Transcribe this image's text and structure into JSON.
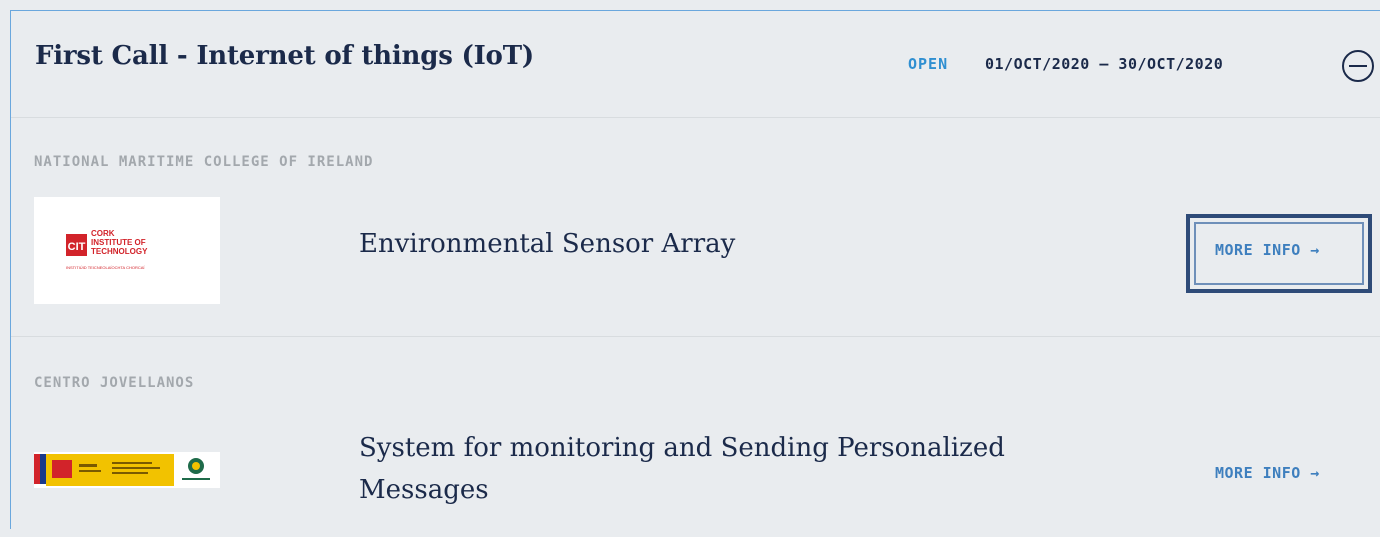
{
  "call": {
    "title": "First Call - Internet of things (IoT)",
    "status": "OPEN",
    "dates": "01/OCT/2020 – 30/OCT/2020",
    "collapse_icon": "minus-circle-icon"
  },
  "entries": [
    {
      "organization": "NATIONAL MARITIME COLLEGE OF IRELAND",
      "logo": {
        "mark": "CIT",
        "line1": "CORK",
        "line2": "INSTITUTE OF",
        "line3": "TECHNOLOGY",
        "tagline": "INSTITIÚID TEICNEOLAÍOCHTA CHORCAÍ"
      },
      "project": "Environmental Sensor Array",
      "link": "MORE INFO →"
    },
    {
      "organization": "CENTRO JOVELLANOS",
      "logo": {
        "alt": "Spanish government and Centro Jovellanos logos"
      },
      "project": "System for monitoring and Sending Personalized Messages",
      "link": "MORE INFO →"
    }
  ],
  "colors": {
    "accent": "#2f8fd1",
    "link": "#3e7fbe",
    "title": "#1b2a4a",
    "muted": "#a3a8ad",
    "background": "#e9ecef",
    "focus_frame": "#2e4b78",
    "cit_red": "#d2232a"
  }
}
